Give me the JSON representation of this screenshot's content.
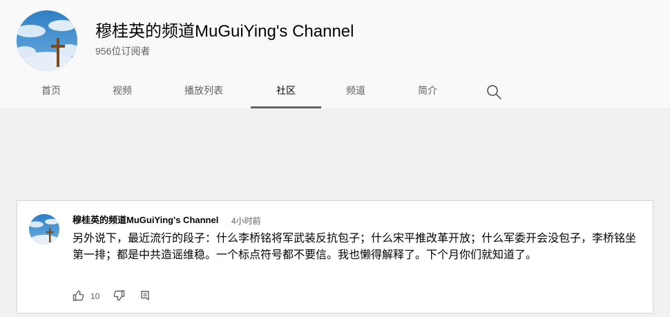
{
  "channel": {
    "name": "穆桂英的频道MuGuiYing's Channel",
    "subscribers": "956位订阅者"
  },
  "tabs": [
    {
      "label": "首页"
    },
    {
      "label": "视频"
    },
    {
      "label": "播放列表"
    },
    {
      "label": "社区",
      "active": true
    },
    {
      "label": "频道"
    },
    {
      "label": "简介"
    }
  ],
  "icons": {
    "search": "search-icon",
    "like": "thumb-up-icon",
    "dislike": "thumb-down-icon",
    "comment": "comment-icon"
  },
  "post": {
    "author": "穆桂英的频道MuGuiYing's Channel",
    "time": "4小时前",
    "text": "另外说下，最近流行的段子：什么李桥铭将军武装反抗包子；什么宋平推改革开放；什么军委开会没包子，李桥铭坐第一排；都是中共造谣维稳。一个标点符号都不要信。我也懒得解释了。下个月你们就知道了。",
    "likes": "10"
  },
  "colors": {
    "header_bg": "#f9f9f9",
    "page_bg": "#f1f1f1",
    "tab_indicator": "#606060"
  }
}
